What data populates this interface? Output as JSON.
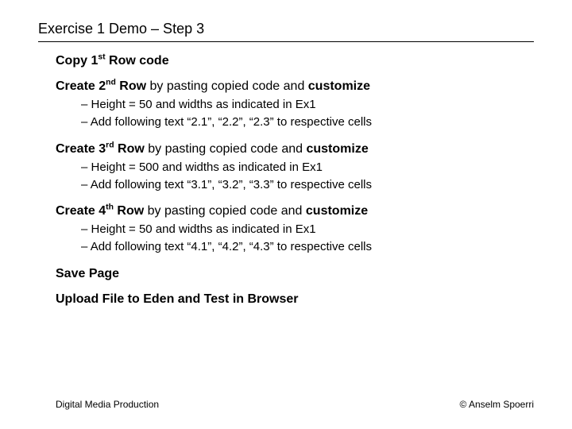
{
  "title": "Exercise 1 Demo – Step 3",
  "sections": {
    "copy": {
      "head_bold": "Copy 1",
      "head_sup": "st",
      "head_bold2": " Row code"
    },
    "row2": {
      "lead_bold": "Create 2",
      "lead_sup": "nd",
      "lead_bold2": " Row",
      "lead_rest": " by pasting copied code and ",
      "lead_trail_bold": "customize",
      "b1": "Height = 50 and widths as indicated in Ex1",
      "b2": "Add following text “2.1”, “2.2”, “2.3” to respective cells"
    },
    "row3": {
      "lead_bold": "Create 3",
      "lead_sup": "rd",
      "lead_bold2": " Row",
      "lead_rest": " by pasting copied code and ",
      "lead_trail_bold": "customize",
      "b1": "Height = 500 and widths as indicated in Ex1",
      "b2": "Add following text “3.1”, “3.2”, “3.3” to respective cells"
    },
    "row4": {
      "lead_bold": "Create 4",
      "lead_sup": "th",
      "lead_bold2": " Row",
      "lead_rest": " by pasting copied code and ",
      "lead_trail_bold": "customize",
      "b1": "Height = 50 and widths as indicated in Ex1",
      "b2": "Add following text “4.1”, “4.2”, “4.3” to respective cells"
    },
    "save": {
      "head_bold": "Save Page"
    },
    "upload": {
      "head_bold": "Upload File to Eden and Test in Browser"
    }
  },
  "footer": {
    "left": "Digital Media Production",
    "right": "© Anselm Spoerri"
  }
}
